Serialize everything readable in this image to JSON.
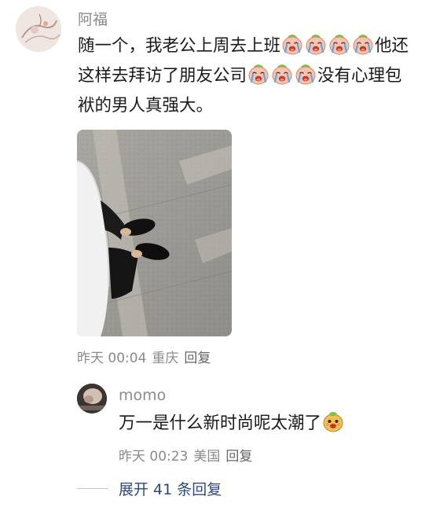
{
  "comment": {
    "username": "阿福",
    "text_segments": [
      {
        "type": "text",
        "value": "随一个，我老公上周去上班"
      },
      {
        "type": "emoji",
        "name": "crying-face-emoji"
      },
      {
        "type": "emoji",
        "name": "crying-face-emoji"
      },
      {
        "type": "emoji",
        "name": "crying-face-emoji"
      },
      {
        "type": "emoji",
        "name": "crying-face-emoji"
      },
      {
        "type": "text",
        "value": "他还这样去拜访了朋友公司"
      },
      {
        "type": "emoji",
        "name": "crying-face-emoji"
      },
      {
        "type": "emoji",
        "name": "crying-face-emoji"
      },
      {
        "type": "emoji",
        "name": "crying-face-emoji"
      },
      {
        "type": "text",
        "value": "没有心理包袱的男人真强大。"
      }
    ],
    "time": "昨天 00:04",
    "location": "重庆",
    "reply_label": "回复"
  },
  "reply": {
    "username": "momo",
    "text_segments": [
      {
        "type": "text",
        "value": "万一是什么新时尚呢太潮了"
      },
      {
        "type": "emoji",
        "name": "doge-emoji"
      }
    ],
    "time": "昨天 00:23",
    "location": "美国",
    "reply_label": "回复"
  },
  "expand": {
    "label": "展开 41 条回复"
  },
  "colors": {
    "meta_gray": "#8a8a8a",
    "link_blue": "#2f4a78"
  }
}
